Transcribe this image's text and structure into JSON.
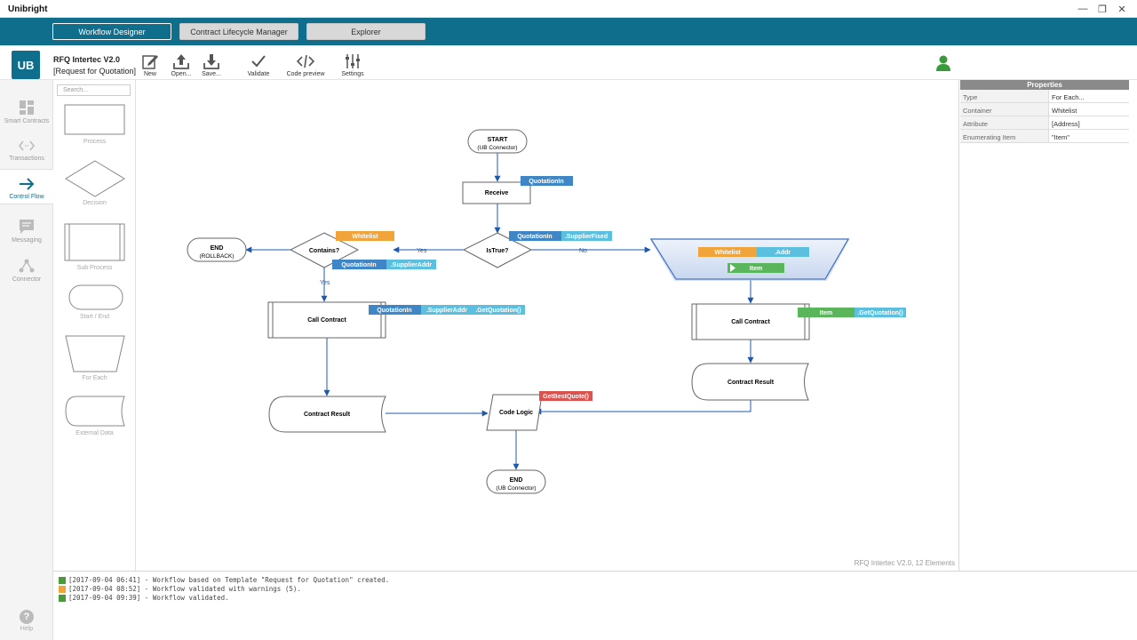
{
  "window": {
    "title": "Unibright",
    "minimize": "—",
    "restore": "❐",
    "close": "✕"
  },
  "modes": [
    {
      "label": "Workflow Designer",
      "active": true
    },
    {
      "label": "Contract Lifecycle Manager",
      "active": false
    },
    {
      "label": "Explorer",
      "active": false
    }
  ],
  "logo": "UB",
  "project": {
    "name": "RFQ Intertec V2.0",
    "template": "[Request for Quotation]"
  },
  "toolbar": {
    "new": "New",
    "open": "Open...",
    "save": "Save...",
    "validate": "Validate",
    "code_preview": "Code preview",
    "settings": "Settings"
  },
  "sidebar": {
    "smart_contracts": "Smart Contracts",
    "transactions": "Transactions",
    "control_flow": "Control Flow",
    "messaging": "Messaging",
    "connector": "Connector",
    "help": "Help"
  },
  "palette": {
    "search_placeholder": "Search...",
    "process": "Process",
    "decision": "Decision",
    "sub_process": "Sub Process",
    "start_end": "Start / End",
    "for_each": "For Each",
    "external_data": "External Data"
  },
  "canvas": {
    "status": "RFQ Intertec V2.0, 12 Elements",
    "start": {
      "line1": "START",
      "line2": "(UB Connector)"
    },
    "receive": "Receive",
    "is_true": "IsTrue?",
    "contains": "Contains?",
    "end_rollback": {
      "line1": "END",
      "line2": "(ROLLBACK)"
    },
    "end_ub": {
      "line1": "END",
      "line2": "(UB Connector)"
    },
    "call_contract_left": "Call Contract",
    "call_contract_right": "Call Contract",
    "contract_result_left": "Contract Result",
    "contract_result_right": "Contract Result",
    "code_logic": "Code Logic",
    "edge_yes1": "Yes",
    "edge_yes2": "Yes",
    "edge_no": "No",
    "tags": {
      "quotation_in_receive": "QuotationIn",
      "quotation_in_istrue": "QuotationIn",
      "supplier_fixed": ".SupplierFixed",
      "whitelist_contains": "Whitelist",
      "quotation_in_contains": "QuotationIn",
      "supplier_addr_contains": ".SupplierAddr",
      "quotation_in_call": "QuotationIn",
      "supplier_addr_call": ".SupplierAddr",
      "get_quotation_left": ".GetQuotation()",
      "whitelist_foreach": "Whitelist",
      "addr_foreach": ".Addr",
      "item_foreach": "Item",
      "item_call": "Item",
      "get_quotation_right": ".GetQuotation()",
      "get_best_quote": "GetBestQuote()"
    }
  },
  "properties": {
    "header": "Properties",
    "rows": [
      {
        "key": "Type",
        "value": "For Each..."
      },
      {
        "key": "Container",
        "value": "Whitelist"
      },
      {
        "key": "Attribute",
        "value": "[Address]"
      },
      {
        "key": "Enumerating Item",
        "value": "\"Item\""
      }
    ]
  },
  "log": [
    {
      "text": "[2017-09-04 06:41] - Workflow based on Template \"Request for Quotation\" created.",
      "color": "#4a9a3a"
    },
    {
      "text": "[2017-09-04 08:52] - Workflow validated with warnings (5).",
      "color": "#f0a43a"
    },
    {
      "text": "[2017-09-04 09:39] - Workflow validated.",
      "color": "#4a9a3a"
    }
  ],
  "colors": {
    "brand": "#0f6e8b",
    "tag_blue_dark": "#3f86c6",
    "tag_blue_light": "#5bc0e0",
    "tag_orange": "#f0a43a",
    "tag_green": "#5bb55b",
    "tag_red": "#d9534f",
    "edge": "#1f5aa8"
  }
}
